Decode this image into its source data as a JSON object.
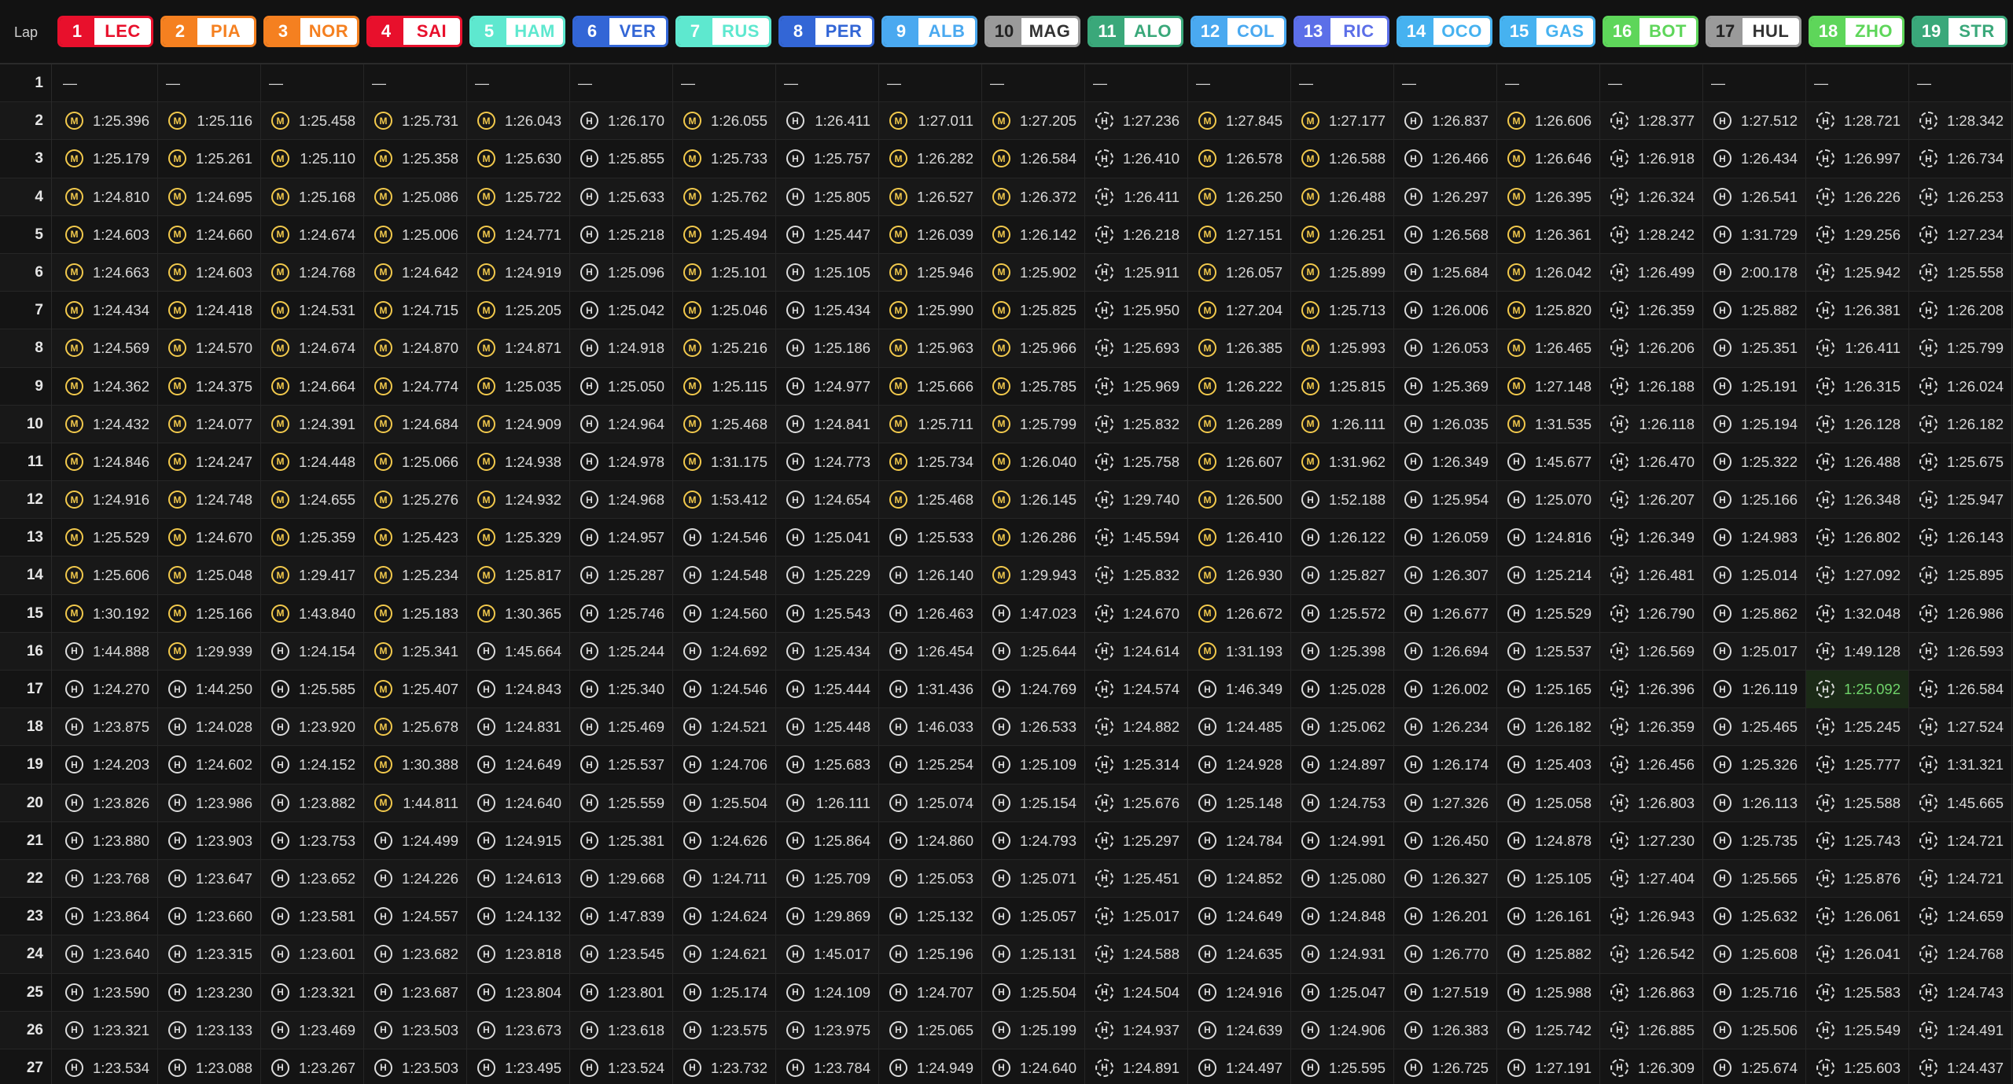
{
  "header": {
    "lap_label": "Lap"
  },
  "drivers": [
    {
      "pos": "1",
      "code": "LEC",
      "color": "#e8102c"
    },
    {
      "pos": "2",
      "code": "PIA",
      "color": "#f58020"
    },
    {
      "pos": "3",
      "code": "NOR",
      "color": "#f58020"
    },
    {
      "pos": "4",
      "code": "SAI",
      "color": "#e8102c"
    },
    {
      "pos": "5",
      "code": "HAM",
      "color": "#5ee8cf"
    },
    {
      "pos": "6",
      "code": "VER",
      "color": "#3366d6"
    },
    {
      "pos": "7",
      "code": "RUS",
      "color": "#5ee8cf"
    },
    {
      "pos": "8",
      "code": "PER",
      "color": "#3366d6"
    },
    {
      "pos": "9",
      "code": "ALB",
      "color": "#4aa9f0"
    },
    {
      "pos": "10",
      "code": "MAG",
      "color": "#9a9a9a"
    },
    {
      "pos": "11",
      "code": "ALO",
      "color": "#3aa87a"
    },
    {
      "pos": "12",
      "code": "COL",
      "color": "#4aa9f0"
    },
    {
      "pos": "13",
      "code": "RIC",
      "color": "#5c6fe8"
    },
    {
      "pos": "14",
      "code": "OCO",
      "color": "#46b2f0"
    },
    {
      "pos": "15",
      "code": "GAS",
      "color": "#46b2f0"
    },
    {
      "pos": "16",
      "code": "BOT",
      "color": "#5ed65a"
    },
    {
      "pos": "17",
      "code": "HUL",
      "color": "#9a9a9a"
    },
    {
      "pos": "18",
      "code": "ZHO",
      "color": "#5ed65a"
    },
    {
      "pos": "19",
      "code": "STR",
      "color": "#3aa87a"
    }
  ],
  "tyre_icons": {
    "M": "medium-tyre-icon",
    "H": "hard-tyre-icon",
    "I": "hard-tyre-used-icon"
  },
  "first_lap_placeholder": "—",
  "laps": [
    {
      "n": "1",
      "t": [
        "—",
        "—",
        "—",
        "—",
        "—",
        "—",
        "—",
        "—",
        "—",
        "—",
        "—",
        "—",
        "—",
        "—",
        "—",
        "—",
        "—",
        "—",
        "—"
      ]
    },
    {
      "n": "2",
      "t": [
        "1:25.396",
        "1:25.116",
        "1:25.458",
        "1:25.731",
        "1:26.043",
        "1:26.170",
        "1:26.055",
        "1:26.411",
        "1:27.011",
        "1:27.205",
        "1:27.236",
        "1:27.845",
        "1:27.177",
        "1:26.837",
        "1:26.606",
        "1:28.377",
        "1:27.512",
        "1:28.721",
        "1:28.342"
      ]
    },
    {
      "n": "3",
      "t": [
        "1:25.179",
        "1:25.261",
        "1:25.110",
        "1:25.358",
        "1:25.630",
        "1:25.855",
        "1:25.733",
        "1:25.757",
        "1:26.282",
        "1:26.584",
        "1:26.410",
        "1:26.578",
        "1:26.588",
        "1:26.466",
        "1:26.646",
        "1:26.918",
        "1:26.434",
        "1:26.997",
        "1:26.734"
      ]
    },
    {
      "n": "4",
      "t": [
        "1:24.810",
        "1:24.695",
        "1:25.168",
        "1:25.086",
        "1:25.722",
        "1:25.633",
        "1:25.762",
        "1:25.805",
        "1:26.527",
        "1:26.372",
        "1:26.411",
        "1:26.250",
        "1:26.488",
        "1:26.297",
        "1:26.395",
        "1:26.324",
        "1:26.541",
        "1:26.226",
        "1:26.253"
      ]
    },
    {
      "n": "5",
      "t": [
        "1:24.603",
        "1:24.660",
        "1:24.674",
        "1:25.006",
        "1:24.771",
        "1:25.218",
        "1:25.494",
        "1:25.447",
        "1:26.039",
        "1:26.142",
        "1:26.218",
        "1:27.151",
        "1:26.251",
        "1:26.568",
        "1:26.361",
        "1:28.242",
        "1:31.729",
        "1:29.256",
        "1:27.234"
      ]
    },
    {
      "n": "6",
      "t": [
        "1:24.663",
        "1:24.603",
        "1:24.768",
        "1:24.642",
        "1:24.919",
        "1:25.096",
        "1:25.101",
        "1:25.105",
        "1:25.946",
        "1:25.902",
        "1:25.911",
        "1:26.057",
        "1:25.899",
        "1:25.684",
        "1:26.042",
        "1:26.499",
        "2:00.178",
        "1:25.942",
        "1:25.558"
      ]
    },
    {
      "n": "7",
      "t": [
        "1:24.434",
        "1:24.418",
        "1:24.531",
        "1:24.715",
        "1:25.205",
        "1:25.042",
        "1:25.046",
        "1:25.434",
        "1:25.990",
        "1:25.825",
        "1:25.950",
        "1:27.204",
        "1:25.713",
        "1:26.006",
        "1:25.820",
        "1:26.359",
        "1:25.882",
        "1:26.381",
        "1:26.208"
      ]
    },
    {
      "n": "8",
      "t": [
        "1:24.569",
        "1:24.570",
        "1:24.674",
        "1:24.870",
        "1:24.871",
        "1:24.918",
        "1:25.216",
        "1:25.186",
        "1:25.963",
        "1:25.966",
        "1:25.693",
        "1:26.385",
        "1:25.993",
        "1:26.053",
        "1:26.465",
        "1:26.206",
        "1:25.351",
        "1:26.411",
        "1:25.799"
      ]
    },
    {
      "n": "9",
      "t": [
        "1:24.362",
        "1:24.375",
        "1:24.664",
        "1:24.774",
        "1:25.035",
        "1:25.050",
        "1:25.115",
        "1:24.977",
        "1:25.666",
        "1:25.785",
        "1:25.969",
        "1:26.222",
        "1:25.815",
        "1:25.369",
        "1:27.148",
        "1:26.188",
        "1:25.191",
        "1:26.315",
        "1:26.024"
      ]
    },
    {
      "n": "10",
      "t": [
        "1:24.432",
        "1:24.077",
        "1:24.391",
        "1:24.684",
        "1:24.909",
        "1:24.964",
        "1:25.468",
        "1:24.841",
        "1:25.711",
        "1:25.799",
        "1:25.832",
        "1:26.289",
        "1:26.111",
        "1:26.035",
        "1:31.535",
        "1:26.118",
        "1:25.194",
        "1:26.128",
        "1:26.182"
      ]
    },
    {
      "n": "11",
      "t": [
        "1:24.846",
        "1:24.247",
        "1:24.448",
        "1:25.066",
        "1:24.938",
        "1:24.978",
        "1:31.175",
        "1:24.773",
        "1:25.734",
        "1:26.040",
        "1:25.758",
        "1:26.607",
        "1:31.962",
        "1:26.349",
        "1:45.677",
        "1:26.470",
        "1:25.322",
        "1:26.488",
        "1:25.675"
      ]
    },
    {
      "n": "12",
      "t": [
        "1:24.916",
        "1:24.748",
        "1:24.655",
        "1:25.276",
        "1:24.932",
        "1:24.968",
        "1:53.412",
        "1:24.654",
        "1:25.468",
        "1:26.145",
        "1:29.740",
        "1:26.500",
        "1:52.188",
        "1:25.954",
        "1:25.070",
        "1:26.207",
        "1:25.166",
        "1:26.348",
        "1:25.947"
      ]
    },
    {
      "n": "13",
      "t": [
        "1:25.529",
        "1:24.670",
        "1:25.359",
        "1:25.423",
        "1:25.329",
        "1:24.957",
        "1:24.546",
        "1:25.041",
        "1:25.533",
        "1:26.286",
        "1:45.594",
        "1:26.410",
        "1:26.122",
        "1:26.059",
        "1:24.816",
        "1:26.349",
        "1:24.983",
        "1:26.802",
        "1:26.143"
      ]
    },
    {
      "n": "14",
      "t": [
        "1:25.606",
        "1:25.048",
        "1:29.417",
        "1:25.234",
        "1:25.817",
        "1:25.287",
        "1:24.548",
        "1:25.229",
        "1:26.140",
        "1:29.943",
        "1:25.832",
        "1:26.930",
        "1:25.827",
        "1:26.307",
        "1:25.214",
        "1:26.481",
        "1:25.014",
        "1:27.092",
        "1:25.895"
      ]
    },
    {
      "n": "15",
      "t": [
        "1:30.192",
        "1:25.166",
        "1:43.840",
        "1:25.183",
        "1:30.365",
        "1:25.746",
        "1:24.560",
        "1:25.543",
        "1:26.463",
        "1:47.023",
        "1:24.670",
        "1:26.672",
        "1:25.572",
        "1:26.677",
        "1:25.529",
        "1:26.790",
        "1:25.862",
        "1:32.048",
        "1:26.986"
      ]
    },
    {
      "n": "16",
      "t": [
        "1:44.888",
        "1:29.939",
        "1:24.154",
        "1:25.341",
        "1:45.664",
        "1:25.244",
        "1:24.692",
        "1:25.434",
        "1:26.454",
        "1:25.644",
        "1:24.614",
        "1:31.193",
        "1:25.398",
        "1:26.694",
        "1:25.537",
        "1:26.569",
        "1:25.017",
        "1:49.128",
        "1:26.593"
      ]
    },
    {
      "n": "17",
      "t": [
        "1:24.270",
        "1:44.250",
        "1:25.585",
        "1:25.407",
        "1:24.843",
        "1:25.340",
        "1:24.546",
        "1:25.444",
        "1:31.436",
        "1:24.769",
        "1:24.574",
        "1:46.349",
        "1:25.028",
        "1:26.002",
        "1:25.165",
        "1:26.396",
        "1:26.119",
        "1:25.092",
        "1:26.584"
      ]
    },
    {
      "n": "18",
      "t": [
        "1:23.875",
        "1:24.028",
        "1:23.920",
        "1:25.678",
        "1:24.831",
        "1:25.469",
        "1:24.521",
        "1:25.448",
        "1:46.033",
        "1:26.533",
        "1:24.882",
        "1:24.485",
        "1:25.062",
        "1:26.234",
        "1:26.182",
        "1:26.359",
        "1:25.465",
        "1:25.245",
        "1:27.524"
      ]
    },
    {
      "n": "19",
      "t": [
        "1:24.203",
        "1:24.602",
        "1:24.152",
        "1:30.388",
        "1:24.649",
        "1:25.537",
        "1:24.706",
        "1:25.683",
        "1:25.254",
        "1:25.109",
        "1:25.314",
        "1:24.928",
        "1:24.897",
        "1:26.174",
        "1:25.403",
        "1:26.456",
        "1:25.326",
        "1:25.777",
        "1:31.321"
      ]
    },
    {
      "n": "20",
      "t": [
        "1:23.826",
        "1:23.986",
        "1:23.882",
        "1:44.811",
        "1:24.640",
        "1:25.559",
        "1:25.504",
        "1:26.111",
        "1:25.074",
        "1:25.154",
        "1:25.676",
        "1:25.148",
        "1:24.753",
        "1:27.326",
        "1:25.058",
        "1:26.803",
        "1:26.113",
        "1:25.588",
        "1:45.665"
      ]
    },
    {
      "n": "21",
      "t": [
        "1:23.880",
        "1:23.903",
        "1:23.753",
        "1:24.499",
        "1:24.915",
        "1:25.381",
        "1:24.626",
        "1:25.864",
        "1:24.860",
        "1:24.793",
        "1:25.297",
        "1:24.784",
        "1:24.991",
        "1:26.450",
        "1:24.878",
        "1:27.230",
        "1:25.735",
        "1:25.743",
        "1:24.721"
      ]
    },
    {
      "n": "22",
      "t": [
        "1:23.768",
        "1:23.647",
        "1:23.652",
        "1:24.226",
        "1:24.613",
        "1:29.668",
        "1:24.711",
        "1:25.709",
        "1:25.053",
        "1:25.071",
        "1:25.451",
        "1:24.852",
        "1:25.080",
        "1:26.327",
        "1:25.105",
        "1:27.404",
        "1:25.565",
        "1:25.876",
        "1:24.721"
      ]
    },
    {
      "n": "23",
      "t": [
        "1:23.864",
        "1:23.660",
        "1:23.581",
        "1:24.557",
        "1:24.132",
        "1:47.839",
        "1:24.624",
        "1:29.869",
        "1:25.132",
        "1:25.057",
        "1:25.017",
        "1:24.649",
        "1:24.848",
        "1:26.201",
        "1:26.161",
        "1:26.943",
        "1:25.632",
        "1:26.061",
        "1:24.659"
      ]
    },
    {
      "n": "24",
      "t": [
        "1:23.640",
        "1:23.315",
        "1:23.601",
        "1:23.682",
        "1:23.818",
        "1:23.545",
        "1:24.621",
        "1:45.017",
        "1:25.196",
        "1:25.131",
        "1:24.588",
        "1:24.635",
        "1:24.931",
        "1:26.770",
        "1:25.882",
        "1:26.542",
        "1:25.608",
        "1:26.041",
        "1:24.768"
      ]
    },
    {
      "n": "25",
      "t": [
        "1:23.590",
        "1:23.230",
        "1:23.321",
        "1:23.687",
        "1:23.804",
        "1:23.801",
        "1:25.174",
        "1:24.109",
        "1:24.707",
        "1:25.504",
        "1:24.504",
        "1:24.916",
        "1:25.047",
        "1:27.519",
        "1:25.988",
        "1:26.863",
        "1:25.716",
        "1:25.583",
        "1:24.743"
      ]
    },
    {
      "n": "26",
      "t": [
        "1:23.321",
        "1:23.133",
        "1:23.469",
        "1:23.503",
        "1:23.673",
        "1:23.618",
        "1:23.575",
        "1:23.975",
        "1:25.065",
        "1:25.199",
        "1:24.937",
        "1:24.639",
        "1:24.906",
        "1:26.383",
        "1:25.742",
        "1:26.885",
        "1:25.506",
        "1:25.549",
        "1:24.491"
      ]
    },
    {
      "n": "27",
      "t": [
        "1:23.534",
        "1:23.088",
        "1:23.267",
        "1:23.503",
        "1:23.495",
        "1:23.524",
        "1:23.732",
        "1:23.784",
        "1:24.949",
        "1:24.640",
        "1:24.891",
        "1:24.497",
        "1:25.595",
        "1:26.725",
        "1:27.191",
        "1:26.309",
        "1:25.674",
        "1:25.603",
        "1:24.437"
      ]
    }
  ],
  "tyre_stints": [
    {
      "from": 2,
      "to": 15,
      "types": [
        "M",
        "M",
        "M",
        "M",
        "M",
        "H",
        "M",
        "H",
        "M",
        "M",
        "I",
        "M",
        "M",
        "H",
        "M",
        "I",
        "H",
        "I",
        "I"
      ]
    }
  ],
  "highlight": {
    "lap": "17",
    "driver": "ZHO",
    "time": "1:25.092",
    "color": "#6fd46a"
  }
}
